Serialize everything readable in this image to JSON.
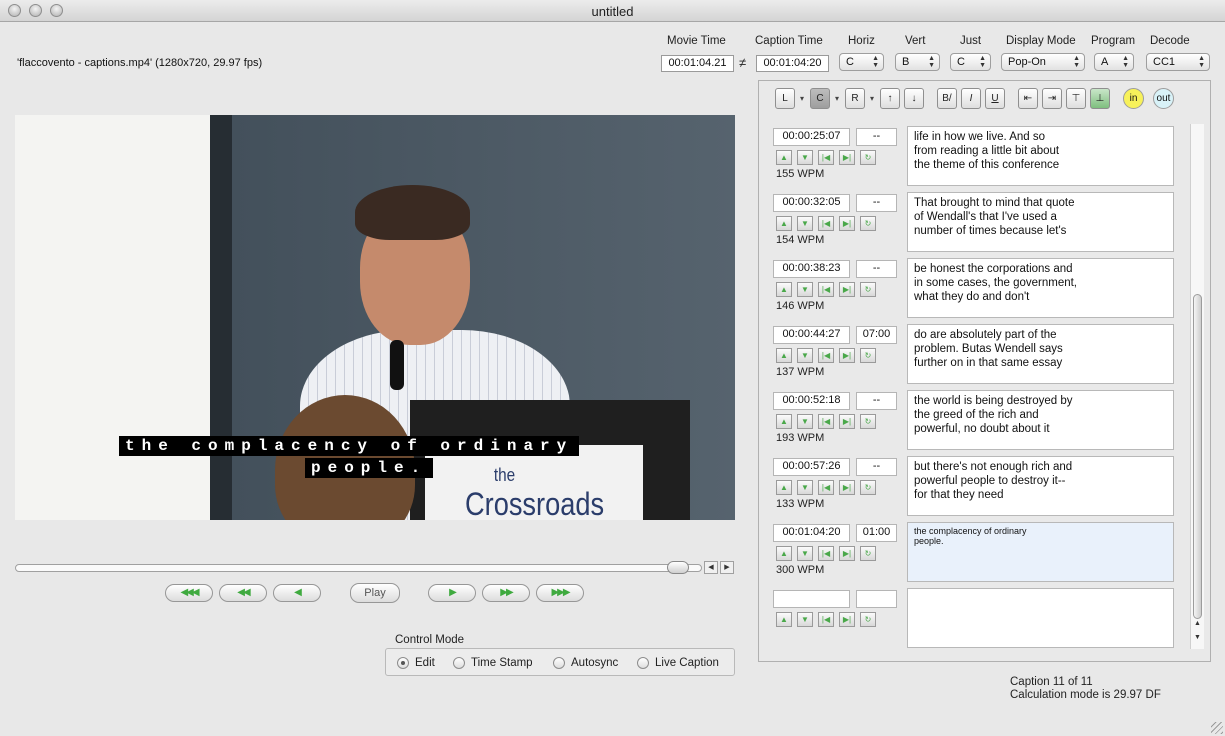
{
  "window": {
    "title": "untitled"
  },
  "file_info": "'flaccovento - captions.mp4'  (1280x720, 29.97 fps)",
  "header": {
    "movie_time_label": "Movie Time",
    "movie_time": "00:01:04.21",
    "neq_symbol": "≠",
    "caption_time_label": "Caption Time",
    "caption_time": "00:01:04:20",
    "horiz_label": "Horiz",
    "horiz_value": "C",
    "vert_label": "Vert",
    "vert_value": "B",
    "just_label": "Just",
    "just_value": "C",
    "display_mode_label": "Display Mode",
    "display_mode_value": "Pop-On",
    "program_label": "Program",
    "program_value": "A",
    "decode_label": "Decode",
    "decode_value": "CC1"
  },
  "video": {
    "caption_line1": "the complacency of ordinary",
    "caption_line2": "people.",
    "sign_text": "the\nCrossroads"
  },
  "transport": {
    "play_label": "Play",
    "buttons": [
      "◀◀◀",
      "◀◀",
      "◀",
      "▶",
      "▶▶",
      "▶▶▶"
    ]
  },
  "control_mode": {
    "label": "Control Mode",
    "options": [
      "Edit",
      "Time Stamp",
      "Autosync",
      "Live Caption"
    ],
    "selected": "Edit"
  },
  "format_toolbar": {
    "buttons": [
      "L",
      "C",
      "R",
      "↑",
      "↓",
      "B/",
      "I",
      "U",
      "⇤",
      "⇥",
      "⊤",
      "⊥"
    ],
    "in_label": "in",
    "out_label": "out",
    "in_color": "#f7f15a",
    "out_color": "#d8f2f8"
  },
  "captions": [
    {
      "time": "00:00:25:07",
      "duration": "--",
      "wpm": "155 WPM",
      "text": "life in how we live. And so\nfrom reading a little bit about\nthe theme of this conference"
    },
    {
      "time": "00:00:32:05",
      "duration": "--",
      "wpm": "154 WPM",
      "text": "That brought to mind that quote\nof Wendall's that I've used a\nnumber of times because let's"
    },
    {
      "time": "00:00:38:23",
      "duration": "--",
      "wpm": "146 WPM",
      "text": "be honest the corporations and\nin some cases, the government,\nwhat they do and don't"
    },
    {
      "time": "00:00:44:27",
      "duration": "07:00",
      "wpm": "137 WPM",
      "text": "do are absolutely part of the\nproblem. Butas Wendell says\nfurther on in that same essay"
    },
    {
      "time": "00:00:52:18",
      "duration": "--",
      "wpm": "193 WPM",
      "text": "the world is being destroyed by\nthe greed of the rich and\npowerful,  no doubt about it"
    },
    {
      "time": "00:00:57:26",
      "duration": "--",
      "wpm": "133 WPM",
      "text": "but there's not enough rich and\npowerful people to destroy it--\nfor that they need"
    },
    {
      "time": "00:01:04:20",
      "duration": "01:00",
      "wpm": "300 WPM",
      "text": "the complacency of ordinary\npeople.",
      "active": true
    },
    {
      "time": "",
      "duration": "",
      "wpm": "",
      "text": ""
    }
  ],
  "row_controls": [
    "▲",
    "▼",
    "|◀",
    "▶|",
    "↻"
  ],
  "status": {
    "caption_count": "Caption 11 of 11",
    "calc_mode": "Calculation mode is 29.97 DF"
  }
}
